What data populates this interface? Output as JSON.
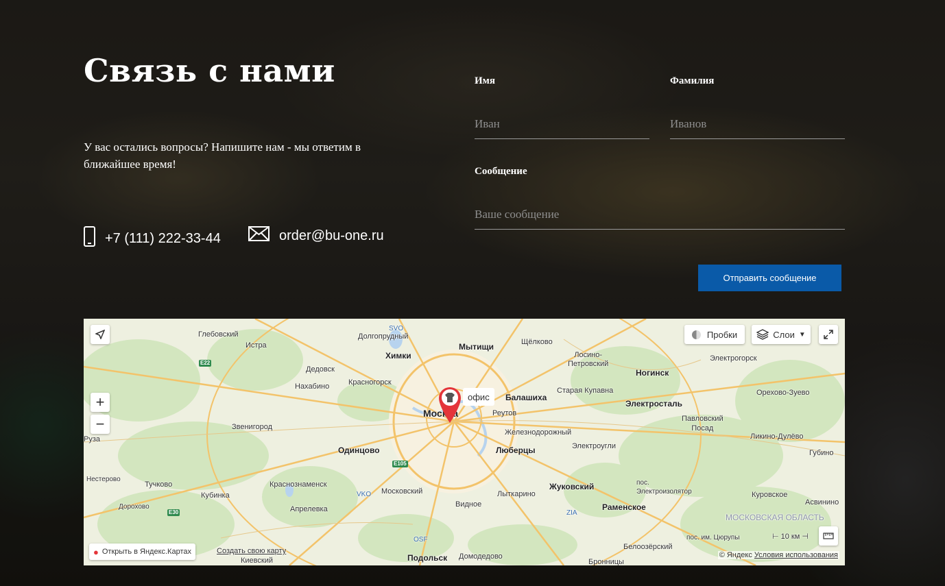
{
  "header": {
    "title": "Связь с нами",
    "intro": "У вас остались вопросы? Напишите нам - мы ответим в ближайшее время!"
  },
  "contacts": {
    "phone": "+7 (111) 222-33-44",
    "email": "order@bu-one.ru",
    "phone_icon": "phone-icon",
    "email_icon": "mail-icon"
  },
  "form": {
    "first_name_label": "Имя",
    "first_name_placeholder": "Иван",
    "last_name_label": "Фамилия",
    "last_name_placeholder": "Иванов",
    "message_label": "Сообщение",
    "message_placeholder": "Ваше сообщение",
    "submit_label": "Отправить сообщение",
    "accent_color": "#0a5aa8"
  },
  "map": {
    "marker_label": "офис",
    "traffic_label": "Пробки",
    "layers_label": "Слои",
    "open_label": "Открыть в Яндекс.Картах",
    "create_label": "Создать свою карту",
    "scale_label": "10 км",
    "copyright": "© Яндекс",
    "terms": "Условия использования",
    "region": "МОСКОВСКАЯ ОБЛАСТЬ",
    "cities": {
      "moscow": "Москва",
      "khimki": "Химки",
      "mytishchi": "Мытищи",
      "shchelkovo": "Щёлково",
      "dolgoprudny": "Долгопрудный",
      "krasnogorsk": "Красногорск",
      "balashikha": "Балашиха",
      "reutov": "Реутов",
      "zheleznodorozhny": "Железнодорожный",
      "lyubertsy": "Люберцы",
      "odintsovo": "Одинцово",
      "noginsk": "Ногинск",
      "elektrostal": "Электросталь",
      "zhukovsky": "Жуковский",
      "ramenskoe": "Раменское",
      "vidnoe": "Видное",
      "podolsk": "Подольск",
      "orekhovo": "Орехово-Зуево",
      "istra": "Истра",
      "glebovsky": "Глебовский",
      "dedovsk": "Дедовск",
      "nakhabino": "Нахабино",
      "zvenigorod": "Звенигород",
      "losino": "Лосино-\nПетровский",
      "elektrogorsk": "Электрогорск",
      "staraya": "Старая Купавна",
      "pavlovsky": "Павловский\nПосад",
      "likino": "Ликино-Дулёво",
      "elektrougli": "Электроугли",
      "gubino": "Губино",
      "elektroizolyator": "пос.\nЭлектроизолятор",
      "kurovskoe": "Куровское",
      "asvinino": "Асвинино",
      "lytkarino": "Лыткарино",
      "moskovsky": "Московский",
      "krasnoznamensk": "Краснознаменск",
      "aprelevka": "Апрелевка",
      "kubinka": "Кубинка",
      "tuchkovo": "Тучково",
      "nesterovo": "Нестерово",
      "dorokhovo": "Дорохово",
      "ruza": "Руза",
      "domodedovo": "Домодедово",
      "beloozersky": "Белоозёрский",
      "bronnitsy": "Бронницы",
      "tsyurupy": "пос. им. Цюрупы",
      "kievsky": "Киевский"
    },
    "airports": [
      "SVO",
      "VKO",
      "OSF",
      "ZIA"
    ],
    "roads": [
      "E22",
      "E105",
      "E30"
    ]
  }
}
